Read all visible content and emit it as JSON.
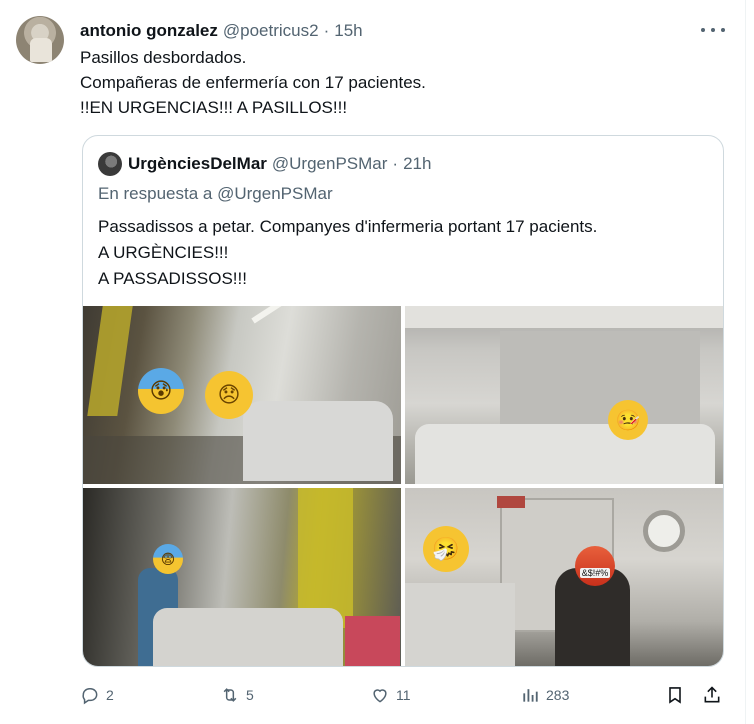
{
  "tweet": {
    "author_name": "antonio gonzalez",
    "author_handle": "@poetricus2",
    "separator": "·",
    "time": "15h",
    "lines": [
      "Pasillos desbordados.",
      "Compañeras de enfermería con 17 pacientes.",
      "!!EN URGENCIAS!!! A PASILLOS!!!"
    ]
  },
  "quote": {
    "author_name": "UrgènciesDelMar",
    "author_handle": "@UrgenPSMar",
    "separator": "·",
    "time": "21h",
    "reply_prefix": "En respuesta a",
    "reply_mention": "@UrgenPSMar",
    "lines": [
      "Passadissos a petar. Companyes d'infermeria portant 17 pacients.",
      "A URGÈNCIES!!!",
      "A PASSADISSOS!!!"
    ],
    "photos": [
      {
        "name": "hallway-photo-1",
        "emojis": [
          "anxious-face-emoji",
          "disappointed-face-emoji"
        ]
      },
      {
        "name": "hallway-photo-2",
        "emojis": [
          "face-with-thermometer-emoji"
        ]
      },
      {
        "name": "hallway-photo-3",
        "emojis": [
          "fearful-face-emoji"
        ]
      },
      {
        "name": "hallway-photo-4",
        "emojis": [
          "sneezing-face-emoji",
          "face-with-symbols-on-mouth-emoji"
        ]
      }
    ],
    "symbols_text": "&$!#%"
  },
  "actions": {
    "replies": "2",
    "reposts": "5",
    "likes": "11",
    "views": "283"
  },
  "icons": {
    "reply": "reply-icon",
    "repost": "repost-icon",
    "like": "heart-icon",
    "views": "views-chart-icon",
    "bookmark": "bookmark-icon",
    "share": "share-icon",
    "more": "more-dots-icon"
  },
  "colors": {
    "text": "#0f1419",
    "secondary": "#536471",
    "border": "#cfd9de"
  }
}
